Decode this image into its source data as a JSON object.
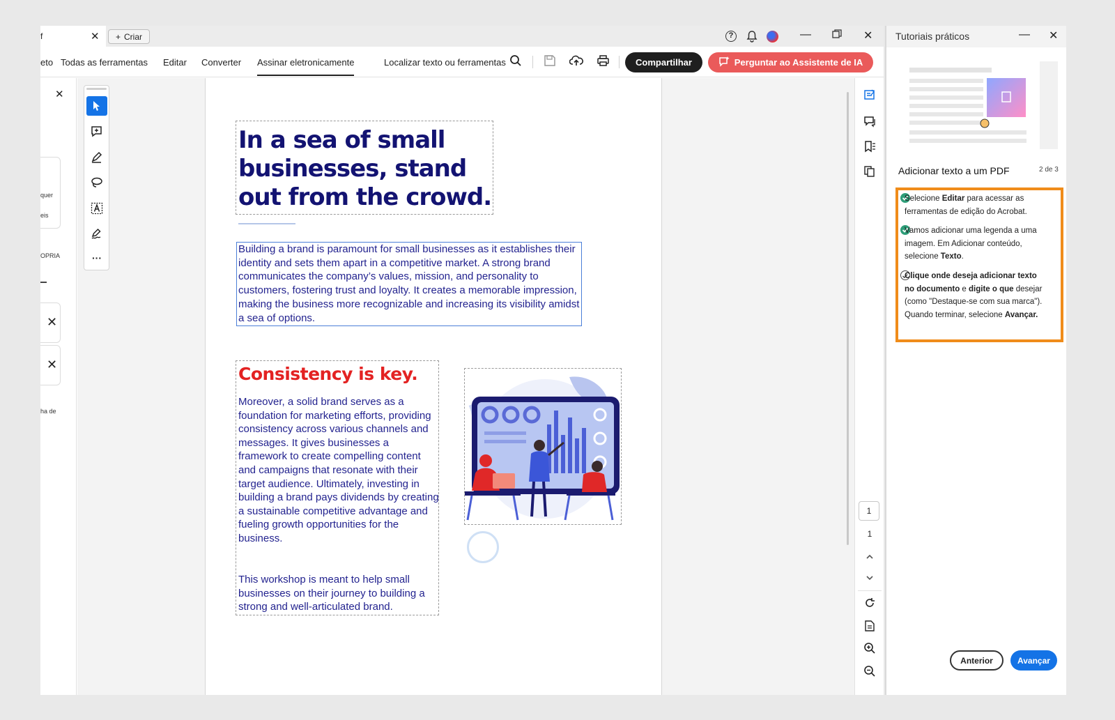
{
  "titlebar": {
    "tab_title": "f",
    "new_button_label": "Criar"
  },
  "menubar": {
    "items": [
      "eto",
      "Todas as ferramentas",
      "Editar",
      "Converter",
      "Assinar eletronicamente"
    ],
    "active": "Assinar eletronicamente",
    "search_label": "Localizar texto ou ferramentas",
    "share_label": "Compartilhar",
    "ai_label": "Perguntar ao Assistente de IA"
  },
  "left_panel": {
    "texts": [
      "quer",
      "eis",
      "OPRIA",
      "ha de"
    ]
  },
  "document": {
    "headline": "In a sea of small businesses, stand out from the crowd.",
    "paragraph1": "Building a brand is paramount for small businesses as it establishes their identity and sets them apart in a competitive market. A strong brand communicates the company’s values, mission, and personality to customers, fostering trust and loyalty. It creates a memorable impression, making the business more recognizable and increasing its visibility amidst a sea of options.",
    "subheading": "Consistency is key.",
    "paragraph2": "Moreover, a solid brand serves as a foundation for marketing efforts, providing consistency across various channels and messages. It gives businesses a framework to create compelling content and campaigns that resonate with their target audience. Ultimately, investing in building a brand pays dividends by creating a sustainable competitive advantage and fueling growth opportunities for the business.",
    "paragraph3": "This workshop is meant to help small businesses on their journey to building a strong and well-articulated brand."
  },
  "page_nav": {
    "current_page": "1",
    "total_pages": "1"
  },
  "tutorial": {
    "panel_title": "Tutoriais práticos",
    "heading": "Adicionar texto a um PDF",
    "step_indicator": "2 de 3",
    "steps": [
      {
        "status": "done",
        "parts": [
          "Selecione ",
          "Editar",
          " para acessar as ferramentas de edição do Acrobat."
        ]
      },
      {
        "status": "done",
        "parts": [
          "Vamos adicionar uma legenda a uma imagem. Em Adicionar conteúdo, selecione ",
          "Texto",
          "."
        ]
      },
      {
        "status": "current",
        "parts": [
          "Clique onde deseja adicionar texto no documento",
          " e ",
          "digite o que",
          " desejar (como \"Destaque-se com sua marca\"). Quando terminar, selecione ",
          "Avançar."
        ]
      }
    ],
    "prev_label": "Anterior",
    "next_label": "Avançar"
  },
  "colors": {
    "accent_blue": "#1473e6",
    "ai_button": "#ea5a5a",
    "highlight_box": "#f08c1a",
    "headline_navy": "#131372",
    "subheading_red": "#e32222",
    "done_check": "#2d9d78"
  }
}
